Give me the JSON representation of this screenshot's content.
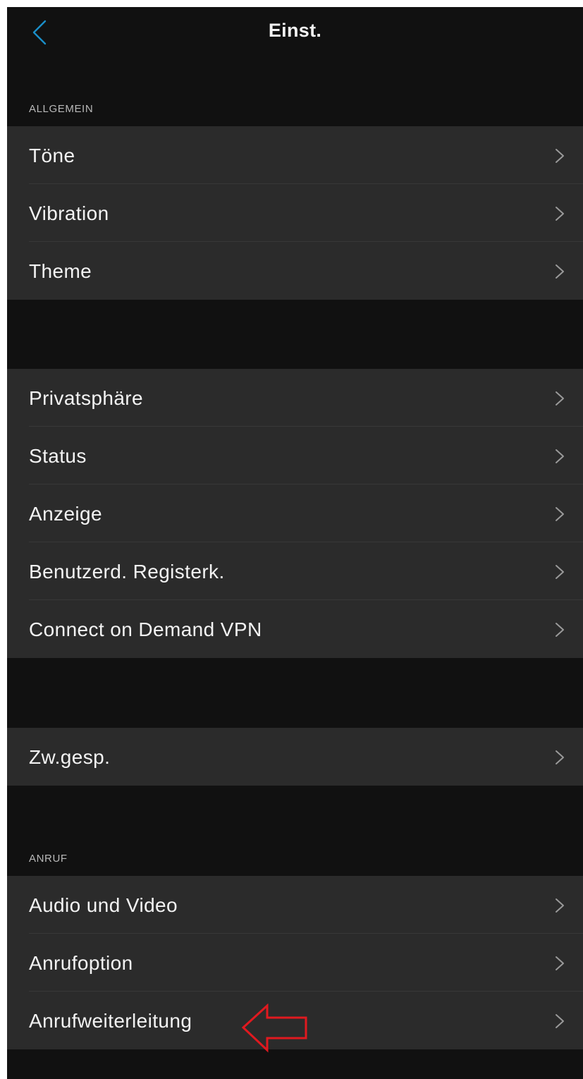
{
  "nav": {
    "title": "Einst.",
    "back_icon": "chevron-left-icon",
    "accent_color": "#1a8fc9"
  },
  "sections": {
    "general_header": "ALLGEMEIN",
    "call_header": "ANRUF"
  },
  "groups": {
    "general": [
      {
        "label": "Töne"
      },
      {
        "label": "Vibration"
      },
      {
        "label": "Theme"
      }
    ],
    "privacy": [
      {
        "label": "Privatsphäre"
      },
      {
        "label": "Status"
      },
      {
        "label": "Anzeige"
      },
      {
        "label": "Benutzerd. Registerk."
      },
      {
        "label": "Connect on Demand VPN"
      }
    ],
    "cache": [
      {
        "label": "Zw.gesp."
      }
    ],
    "call": [
      {
        "label": "Audio und Video"
      },
      {
        "label": "Anrufoption"
      },
      {
        "label": "Anrufweiterleitung"
      }
    ]
  },
  "annotation": {
    "icon": "red-left-arrow-icon",
    "color": "#e0191f"
  },
  "colors": {
    "background": "#111111",
    "cell": "#2b2b2b",
    "text": "#f3f3f3",
    "secondary_text": "#b9b9b9",
    "chevron": "#9a9a9a"
  }
}
